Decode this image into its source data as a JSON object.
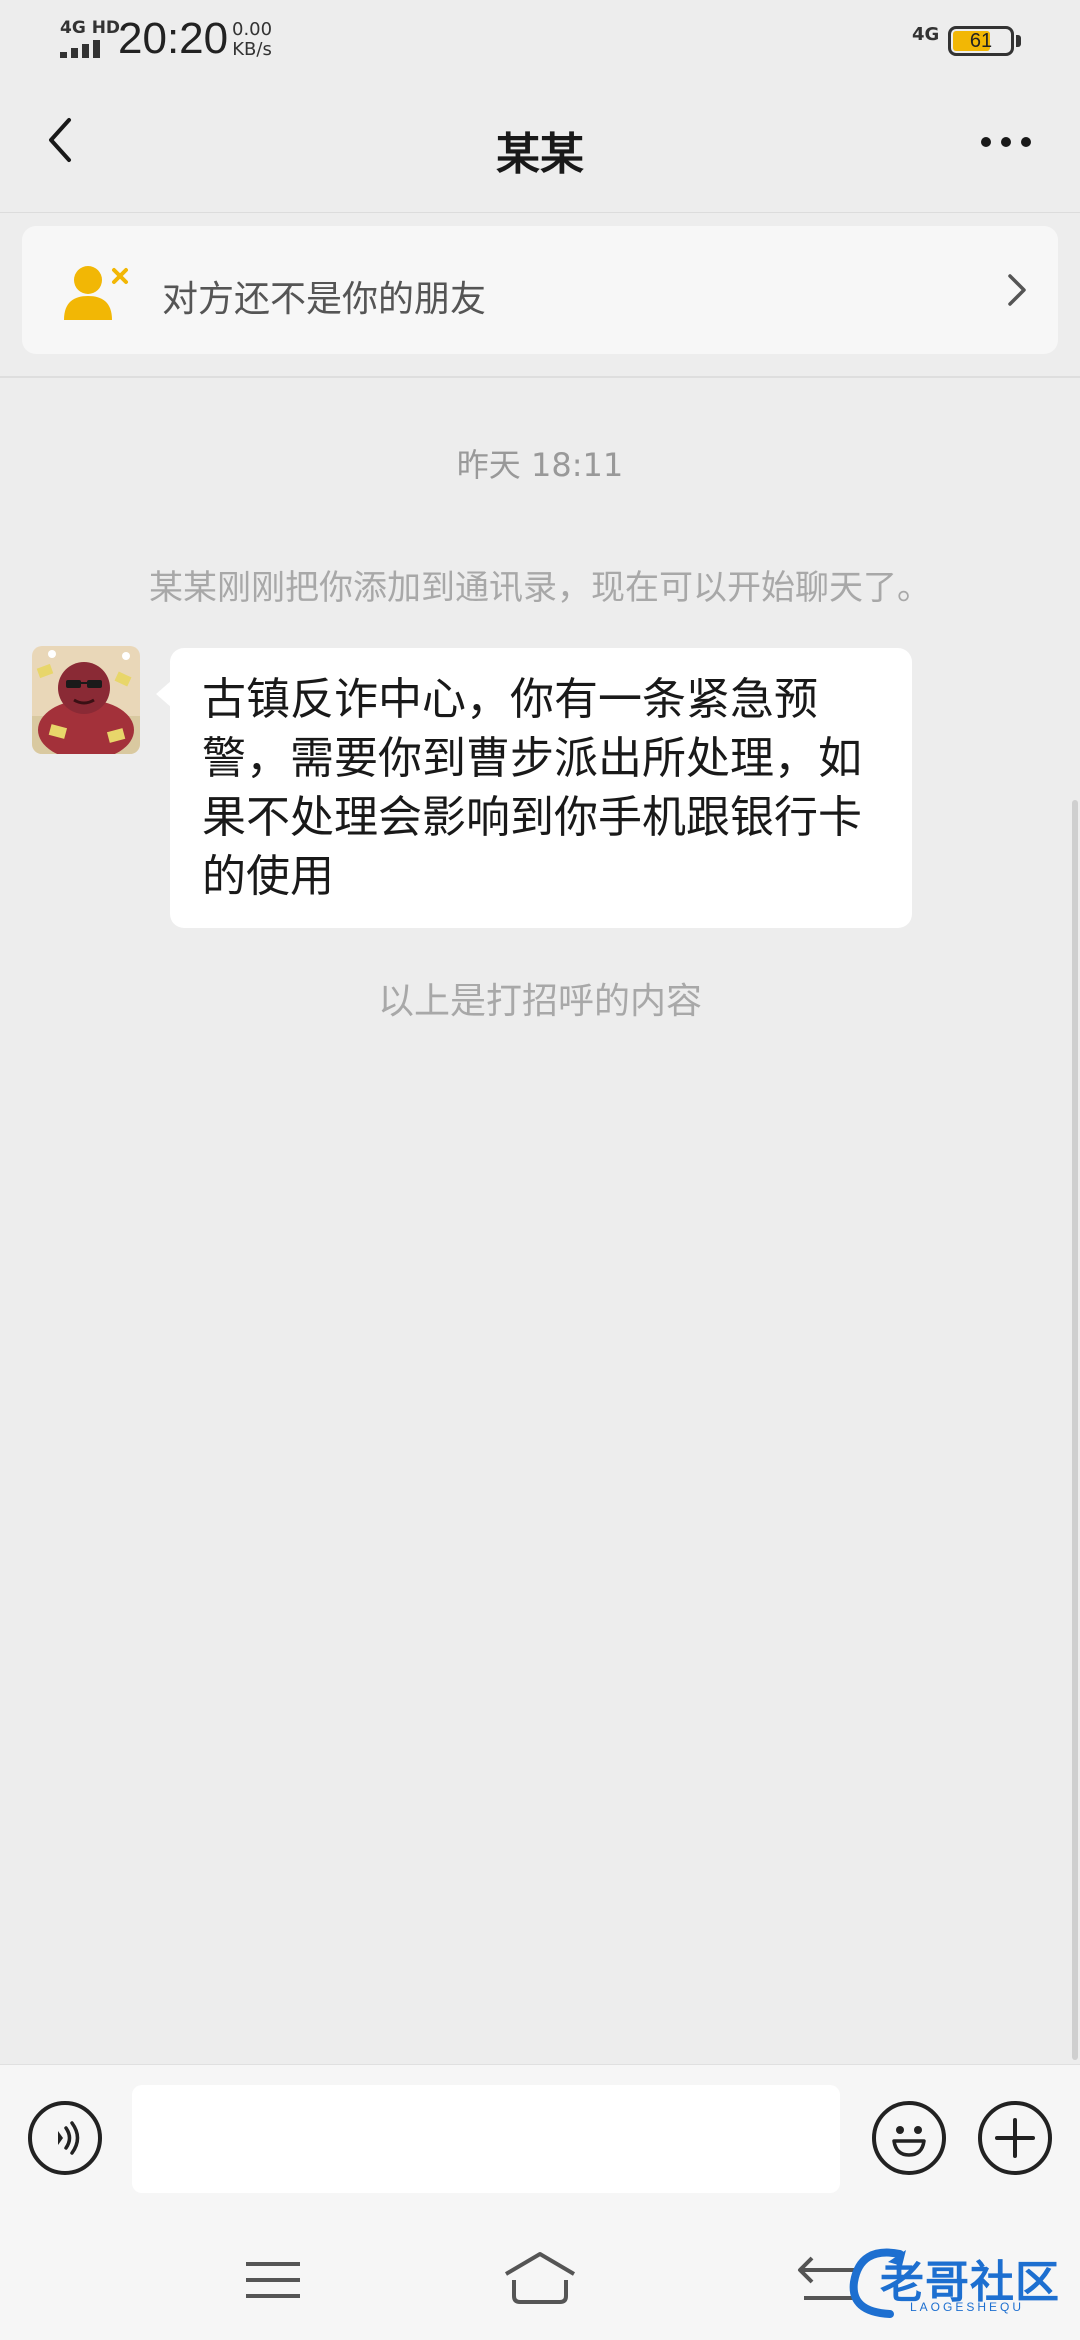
{
  "status_bar": {
    "network_label": "4G HD",
    "time": "20:20",
    "net_speed_value": "0.00",
    "net_speed_unit": "KB/s",
    "network_right": "4G",
    "battery": "61"
  },
  "header": {
    "title": "某某"
  },
  "banner": {
    "text": "对方还不是你的朋友"
  },
  "chat": {
    "timestamp": "昨天 18:11",
    "system_added": "某某刚刚把你添加到通讯录，现在可以开始聊天了。",
    "message": "古镇反诈中心，你有一条紧急预警，需要你到曹步派出所处理，如果不处理会影响到你手机跟银行卡的使用",
    "system_greeting": "以上是打招呼的内容"
  },
  "input_bar": {
    "placeholder": "",
    "value": ""
  },
  "watermark": {
    "text": "老哥社区",
    "sub": "LAOGESHEQU"
  },
  "colors": {
    "background": "#ededed",
    "bubble": "#ffffff",
    "warning_icon": "#f2b705",
    "watermark": "#1d6fd0"
  }
}
